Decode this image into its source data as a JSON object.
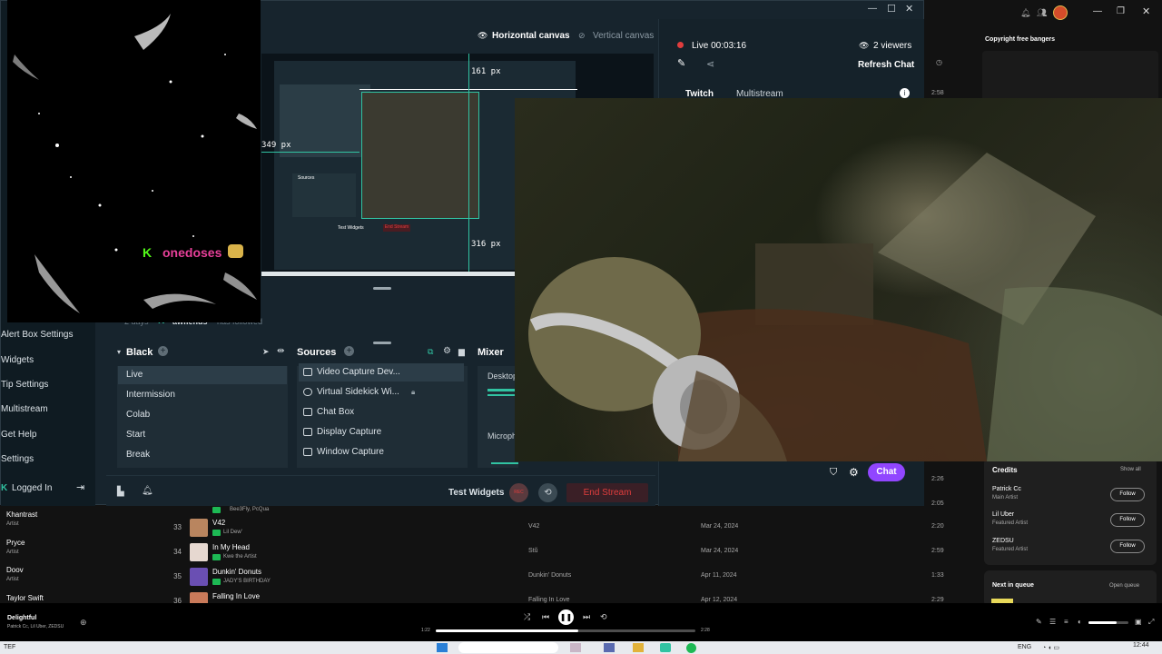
{
  "spotify": {
    "copyright_title": "Copyright free bangers",
    "rows": [
      {
        "num": "",
        "title": "",
        "artists": "Bee3Fly, PcQua",
        "album": "",
        "date": "",
        "dur": "2:05"
      },
      {
        "num": "33",
        "title": "V42",
        "artists": "Lil Dew'",
        "album": "V42",
        "date": "Mar 24, 2024",
        "dur": "2:20"
      },
      {
        "num": "34",
        "title": "In My Head",
        "artists": "Kwe the Artist",
        "album": "Stŭ",
        "date": "Mar 24, 2024",
        "dur": "2:59"
      },
      {
        "num": "35",
        "title": "Dunkin' Donuts",
        "artists": "JADY'S BIRTHDAY",
        "album": "Dunkin' Donuts",
        "date": "Apr 11, 2024",
        "dur": "1:33"
      },
      {
        "num": "36",
        "title": "Falling In Love",
        "artists": "",
        "album": "Falling In Love",
        "date": "Apr 12, 2024",
        "dur": "2:29"
      }
    ],
    "side_durations": [
      "2:58",
      "2:26"
    ],
    "left_artists": [
      {
        "name": "Khantrast",
        "sub": "Artist"
      },
      {
        "name": "Pryce",
        "sub": "Artist"
      },
      {
        "name": "Doov",
        "sub": "Artist"
      },
      {
        "name": "Taylor Swift",
        "sub": ""
      }
    ],
    "credits": {
      "title": "Credits",
      "show_all": "Show all",
      "people": [
        {
          "name": "Patrick Cc",
          "role": "Main Artist",
          "follow": "Follow"
        },
        {
          "name": "Lil Uber",
          "role": "Featured Artist",
          "follow": "Follow"
        },
        {
          "name": "ZEDSU",
          "role": "Featured Artist",
          "follow": "Follow"
        }
      ]
    },
    "queue": {
      "title": "Next in queue",
      "open": "Open queue"
    },
    "player": {
      "track": "Delightful",
      "artists": "Patrick Cc, Lil Uber, ZEDSU",
      "elapsed": "1:22",
      "total": "2:28",
      "progress": 0.55,
      "volume": 0.7
    }
  },
  "taskbar": {
    "left": "TEF",
    "lang": "ENG",
    "time": "12:44"
  },
  "streamlabs": {
    "canvas": {
      "horizontal": "Horizontal canvas",
      "vertical": "Vertical canvas"
    },
    "live": {
      "status": "Live 00:03:16",
      "viewers": "2 viewers",
      "refresh": "Refresh Chat"
    },
    "tabs": {
      "twitch": "Twitch",
      "multistream": "Multistream"
    },
    "dims": {
      "w1": "161 px",
      "w2": "349 px",
      "w3": "316 px"
    },
    "event": {
      "time": "2 days",
      "user": "awfiends",
      "text": "has followed"
    },
    "left_menu": [
      "Alert Box Settings",
      "Widgets",
      "Tip Settings",
      "Multistream",
      "Get Help",
      "Settings",
      "Logged In"
    ],
    "scenes": {
      "title": "Black",
      "items": [
        "Live",
        "Intermission",
        "Colab",
        "Start",
        "Break"
      ]
    },
    "sources": {
      "title": "Sources",
      "items": [
        "Video Capture Dev...",
        "Virtual Sidekick Wi...",
        "Chat Box",
        "Display Capture",
        "Window Capture"
      ]
    },
    "mixer": {
      "title": "Mixer",
      "items": [
        "Desktop",
        "Microph"
      ]
    },
    "footer": {
      "test_widgets": "Test Widgets",
      "rec": "REC",
      "end_stream": "End Stream",
      "chat": "Chat"
    },
    "preview_labels": {
      "test_widgets": "Test Widgets",
      "end_stream": "End Stream",
      "sources": "Sources"
    }
  },
  "overlay": {
    "username": "onedoses"
  },
  "colors": {
    "accent_green": "#31c3a2",
    "live_red": "#e03d3d",
    "chat_purple": "#9146ff",
    "spotify_green": "#1db954",
    "username_pink": "#e8409a"
  }
}
